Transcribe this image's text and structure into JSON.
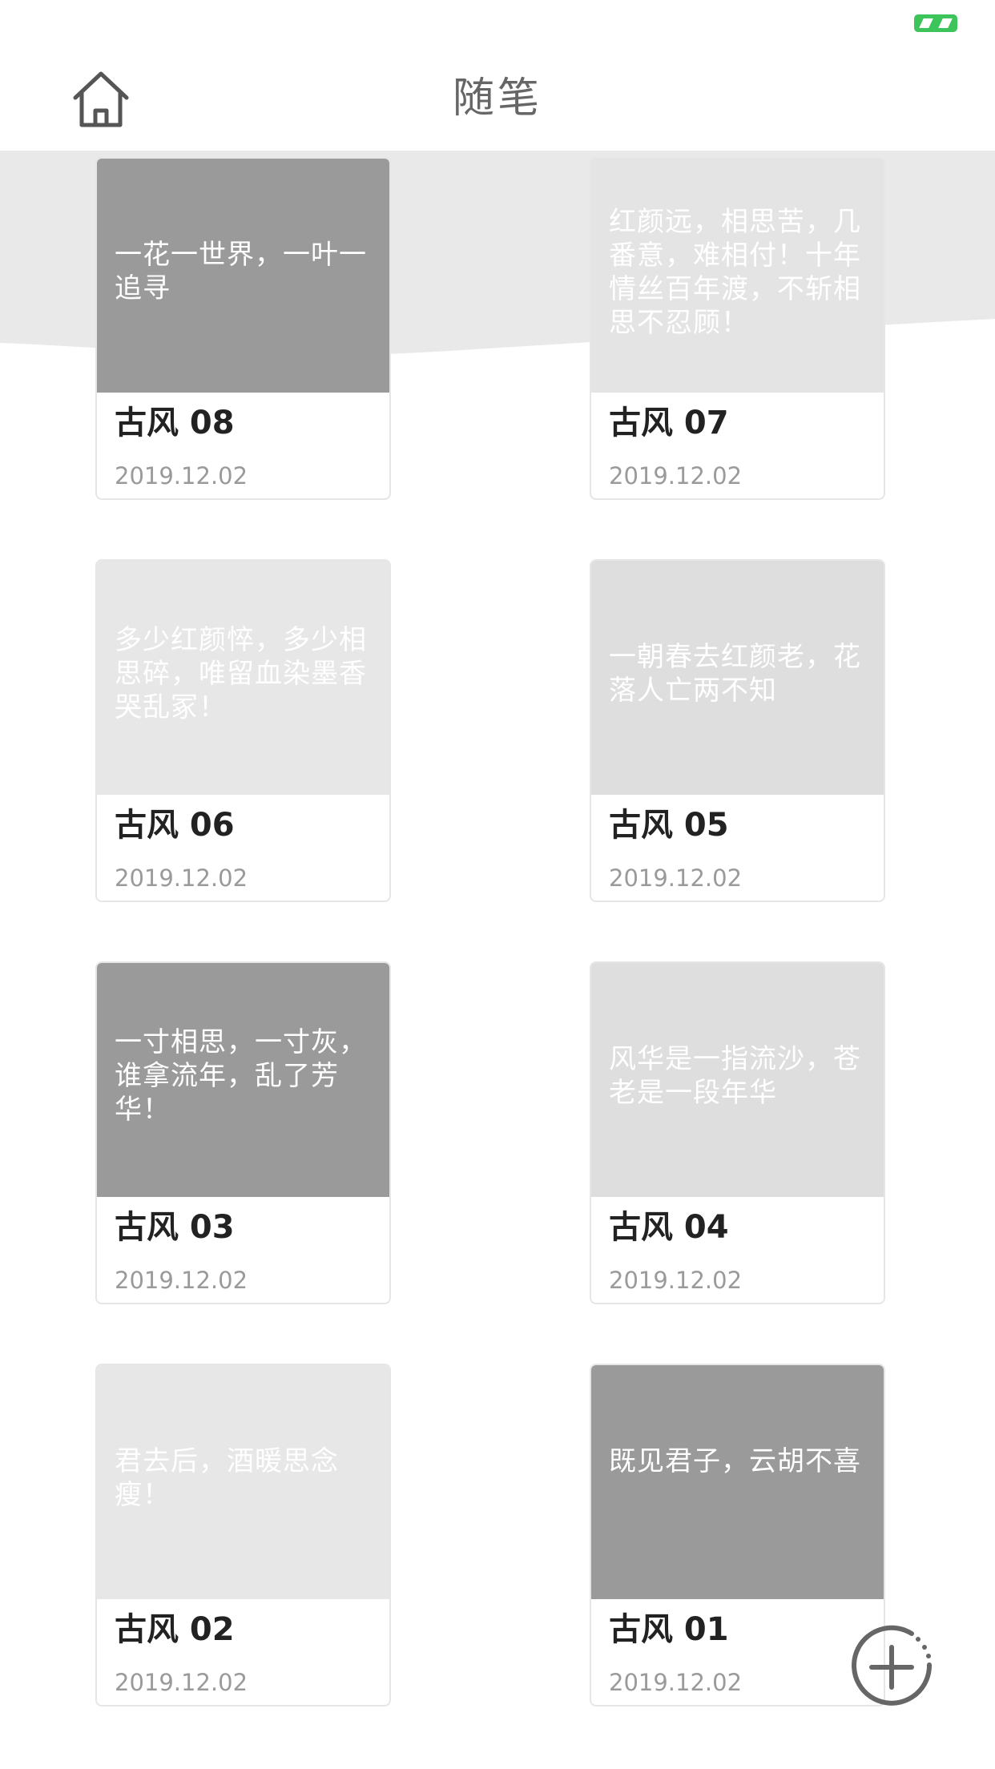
{
  "header": {
    "title": "随笔",
    "home_icon": "home-icon"
  },
  "status": {
    "badge_color": "#3dc45a"
  },
  "cards": [
    {
      "title": "古风 08",
      "date": "2019.12.02",
      "excerpt": "一花一世界，一叶一追寻"
    },
    {
      "title": "古风 07",
      "date": "2019.12.02",
      "excerpt": "红颜远，相思苦，几番意，难相付！十年情丝百年渡，不斩相思不忍顾！"
    },
    {
      "title": "古风 06",
      "date": "2019.12.02",
      "excerpt": "多少红颜悴，多少相思碎，唯留血染墨香哭乱冢！"
    },
    {
      "title": "古风 05",
      "date": "2019.12.02",
      "excerpt": "一朝春去红颜老，花落人亡两不知"
    },
    {
      "title": "古风 03",
      "date": "2019.12.02",
      "excerpt": "一寸相思，一寸灰，谁拿流年，乱了芳华！"
    },
    {
      "title": "古风 04",
      "date": "2019.12.02",
      "excerpt": "风华是一指流沙，苍老是一段年华"
    },
    {
      "title": "古风 02",
      "date": "2019.12.02",
      "excerpt": "君去后，酒暖思念瘦！"
    },
    {
      "title": "古风 01",
      "date": "2019.12.02",
      "excerpt": "既见君子，云胡不喜"
    }
  ],
  "actions": {
    "add_icon": "plus-circle-icon"
  }
}
